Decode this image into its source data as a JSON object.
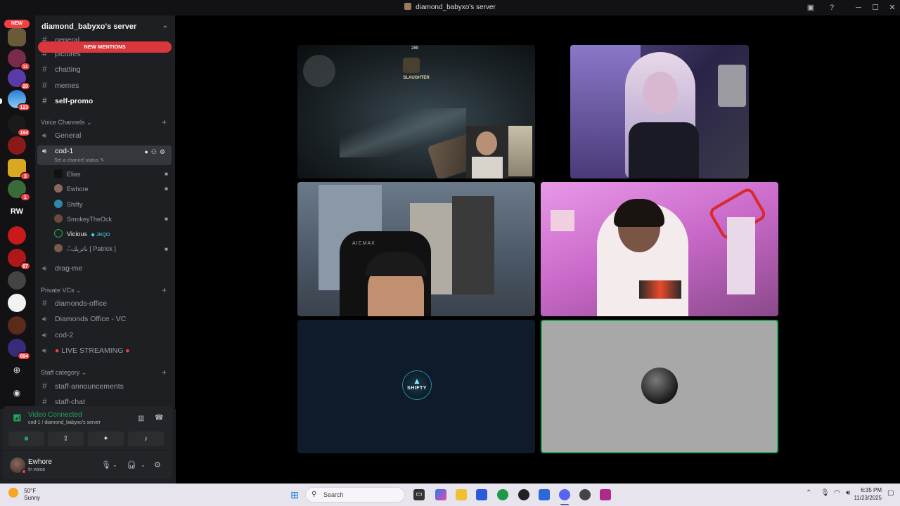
{
  "window": {
    "title": "diamond_babyxo's server"
  },
  "rail": {
    "new_tag": "NEW",
    "logo_text": "RW",
    "badges": [
      "11",
      "20",
      "123",
      "194",
      "3",
      "1",
      "87",
      "684"
    ]
  },
  "sidebar": {
    "server_name": "diamond_babyxo's server",
    "new_mentions": "NEW MENTIONS",
    "text_channels": [
      {
        "name": "general"
      },
      {
        "name": "pictures"
      },
      {
        "name": "chatting"
      },
      {
        "name": "memes"
      },
      {
        "name": "self-promo"
      }
    ],
    "voice_category": "Voice Channels",
    "voice_channels": {
      "general": "General",
      "active": "cod-1",
      "active_status": "Set a channel status",
      "drag": "drag-me"
    },
    "members": [
      {
        "name": "Elias"
      },
      {
        "name": "Ewhore"
      },
      {
        "name": "Shifty"
      },
      {
        "name": "SmokeyTheOck"
      },
      {
        "name": "Vicious",
        "tag": "JRQO"
      },
      {
        "name": "ஃباتريك [ Patrick ]"
      }
    ],
    "private_category": "Private VCs",
    "private_channels": [
      "diamonds-office",
      "Diamonds Office - VC",
      "cod-2",
      "LIVE STREAMING"
    ],
    "staff_category": "Staff category",
    "staff_channels": [
      "staff-announcements",
      "staff-chat"
    ]
  },
  "voice_panel": {
    "status": "Video Connected",
    "location": "cod-1 / diamond_babyxo's server"
  },
  "user_panel": {
    "name": "Ewhore",
    "status": "In voice"
  },
  "stage": {
    "tiles": [
      {
        "label": "game-stream"
      },
      {
        "label": "camera-streamer-purple"
      },
      {
        "label": "camera-room-gaming-chair"
      },
      {
        "label": "camera-pink-room"
      },
      {
        "label": "avatar-shifty"
      },
      {
        "label": "avatar-moon"
      }
    ],
    "game_hud": {
      "title": "SLAUGHTER",
      "score": "289"
    },
    "shifty_avatar_text": "SHIFTY"
  },
  "taskbar": {
    "weather_temp": "50°F",
    "weather_desc": "Sunny",
    "search_placeholder": "Search",
    "time": "6:35 PM",
    "date": "11/23/2025"
  },
  "colors": {
    "accent_red": "#da373c",
    "connected_green": "#23a55a",
    "speaking_green": "#23a55a"
  }
}
